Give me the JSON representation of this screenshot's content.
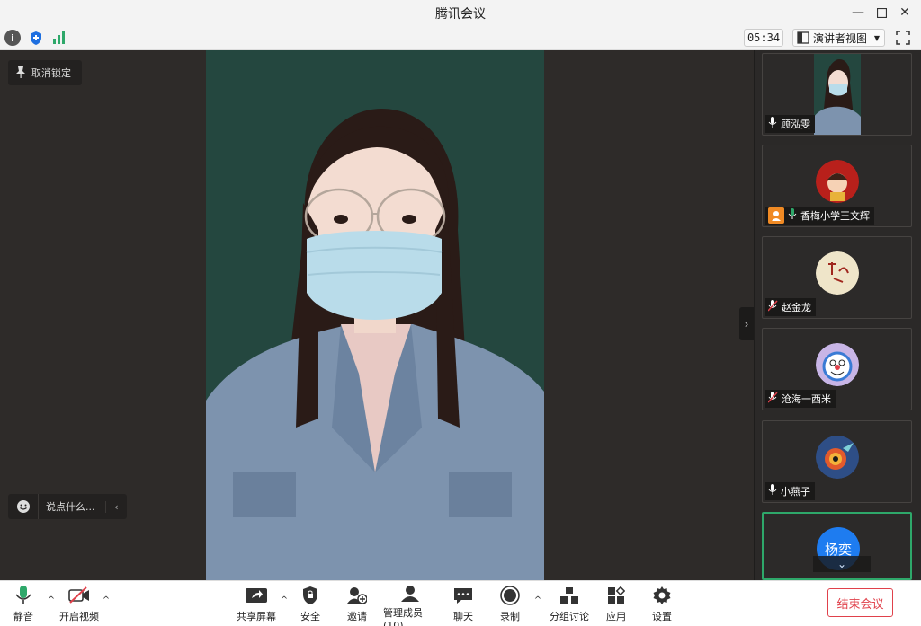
{
  "window": {
    "title": "腾讯会议"
  },
  "infobar": {
    "timer": "05:34",
    "view_mode": "演讲者视图"
  },
  "main": {
    "unlock_label": "取消锁定",
    "chat_placeholder": "说点什么..."
  },
  "participants": [
    {
      "name": "顾泓雯",
      "mic": "on",
      "host": false,
      "avatar": "photo"
    },
    {
      "name": "香梅小学王文辉",
      "mic": "on",
      "host": true,
      "avatar": "red-cartoon"
    },
    {
      "name": "赵金龙",
      "mic": "muted",
      "host": false,
      "avatar": "calligraphy"
    },
    {
      "name": "沧海一西米",
      "mic": "muted",
      "host": false,
      "avatar": "doraemon"
    },
    {
      "name": "小燕子",
      "mic": "on",
      "host": false,
      "avatar": "hummingbird"
    },
    {
      "name": "",
      "mic": "on",
      "host": false,
      "avatar_text": "杨奕",
      "active": true
    }
  ],
  "toolbar": {
    "mute": "静音",
    "video": "开启视频",
    "share": "共享屏幕",
    "security": "安全",
    "invite": "邀请",
    "members": "管理成员(10)",
    "chat": "聊天",
    "record": "录制",
    "breakout": "分组讨论",
    "apps": "应用",
    "settings": "设置",
    "end": "结束会议"
  },
  "colors": {
    "accent_green": "#2ea86a",
    "end_red": "#e0414b",
    "host_orange": "#f08a24",
    "blue_avatar": "#1e7cf0"
  }
}
